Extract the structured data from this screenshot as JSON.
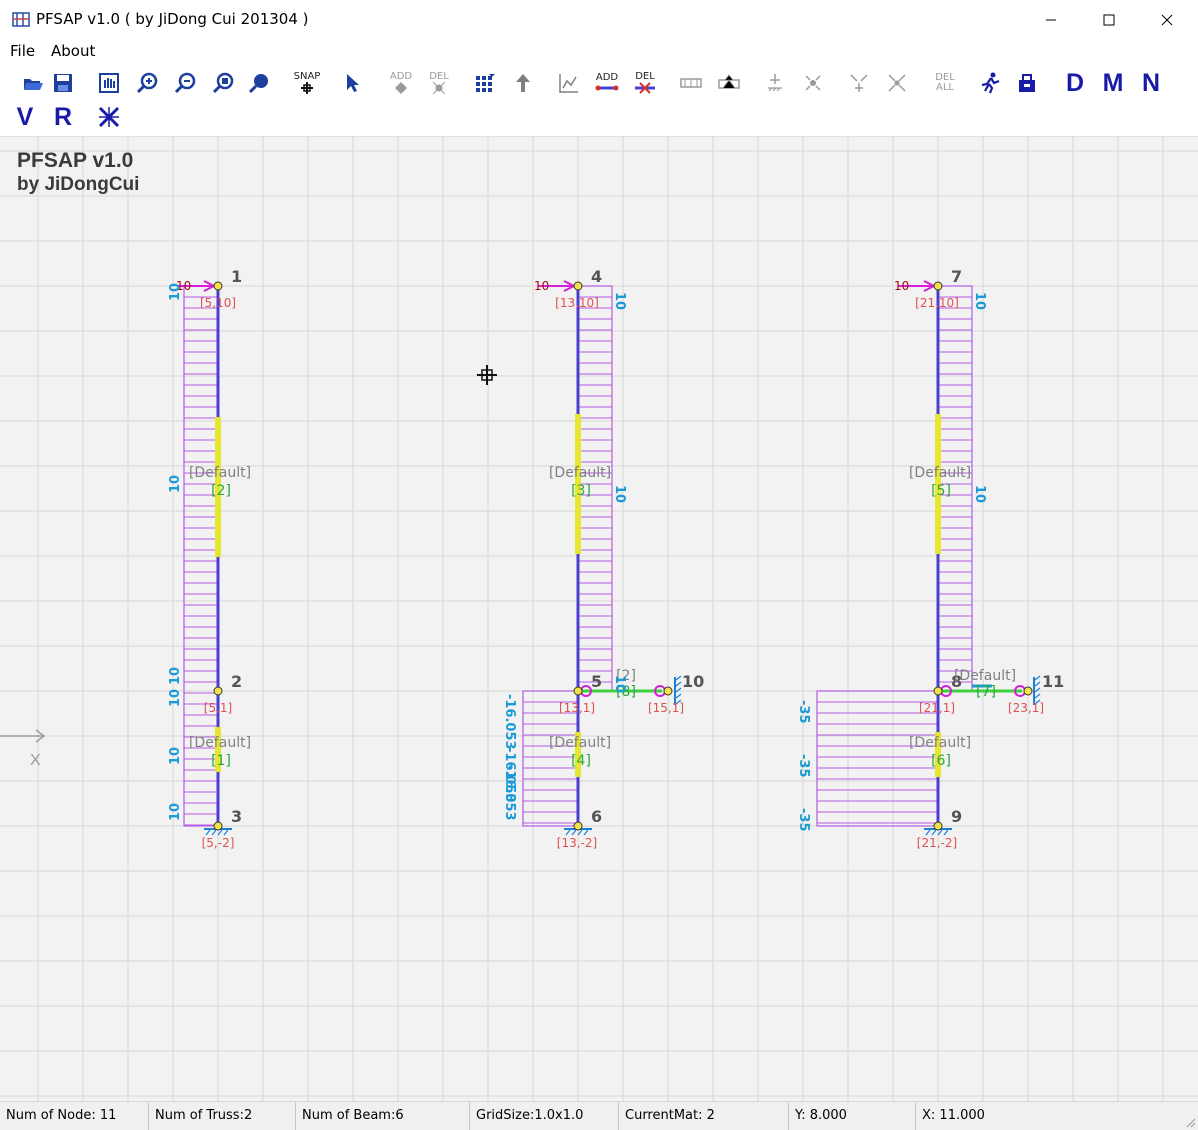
{
  "window": {
    "title": "PFSAP v1.0 ( by JiDong Cui 201304 )"
  },
  "menu": {
    "file": "File",
    "about": "About"
  },
  "toolbar": {
    "snap": "SNAP",
    "add": "ADD",
    "del": "DEL",
    "del_all_1": "DEL",
    "del_all_2": "ALL",
    "letter_d": "D",
    "letter_m": "M",
    "letter_n": "N",
    "letter_v": "V",
    "letter_r": "R"
  },
  "canvas": {
    "heading1": "PFSAP v1.0",
    "heading2": "by JiDongCui",
    "axis_x": "X",
    "nodes": [
      {
        "id": "1",
        "nlabel": "[5,10]"
      },
      {
        "id": "2",
        "nlabel": "[5,1]"
      },
      {
        "id": "3",
        "nlabel": "[5,-2]"
      },
      {
        "id": "4",
        "nlabel": "[13,10]"
      },
      {
        "id": "5",
        "nlabel": "[13,1]"
      },
      {
        "id": "6",
        "nlabel": "[13,-2]"
      },
      {
        "id": "7",
        "nlabel": "[21,10]"
      },
      {
        "id": "8",
        "nlabel": "[21,1]"
      },
      {
        "id": "9",
        "nlabel": "[21,-2]"
      },
      {
        "id": "10",
        "nlabel": "[15,1]"
      },
      {
        "id": "11",
        "nlabel": "[23,1]"
      }
    ],
    "members": [
      {
        "mat": "[Default]",
        "id": "[2]"
      },
      {
        "mat": "[Default]",
        "id": "[1]"
      },
      {
        "mat": "[Default]",
        "id": "[3]"
      },
      {
        "mat": "[Default]",
        "id": "[4]"
      },
      {
        "mat": "[Default]",
        "id": "[5]"
      },
      {
        "mat": "[Default]",
        "id": "[6]"
      },
      {
        "mat": "[2]",
        "id": "[8]"
      },
      {
        "mat": "[Default]",
        "id": "[7]"
      }
    ],
    "load_values": {
      "ten": "10",
      "neg35": "-35",
      "s1": "-16.053",
      "s2": "-16.053",
      "s3": "-16.053"
    }
  },
  "status": {
    "nodes": "Num of Node: 11",
    "truss": "Num of Truss:2",
    "beam": "Num of Beam:6",
    "grid": "GridSize:1.0x1.0",
    "mat": "CurrentMat: 2",
    "y": "Y: 8.000",
    "x": "X: 11.000"
  },
  "colors": {
    "member": "#4a3fd0",
    "diagram": "#b55be6",
    "node_label": "#e05050",
    "member_label": "#808080",
    "member_id": "#2aa83a",
    "value": "#1a9ad6",
    "truss": "#3ed23e",
    "highlight": "#e6e62e",
    "force": "#d51fd5",
    "grid": "#d7d7d7",
    "background": "#f2f2f2"
  },
  "icons": [
    "open-icon",
    "save-icon",
    "pan-icon",
    "zoom-in-icon",
    "zoom-out-icon",
    "zoom-window-icon",
    "zoom-all-icon",
    "snap-icon",
    "select-icon",
    "add-node-icon",
    "del-node-icon",
    "grid-icon",
    "move-icon",
    "chart-icon",
    "add-member-icon",
    "del-member-icon",
    "beam-icon",
    "truss-icon",
    "support-icon",
    "support2-icon",
    "release-icon",
    "release2-icon",
    "del-all-icon",
    "run-icon",
    "load-icon",
    "diagram-d-icon",
    "diagram-m-icon",
    "diagram-n-icon",
    "diagram-v-icon",
    "diagram-r-icon",
    "settings-icon"
  ]
}
